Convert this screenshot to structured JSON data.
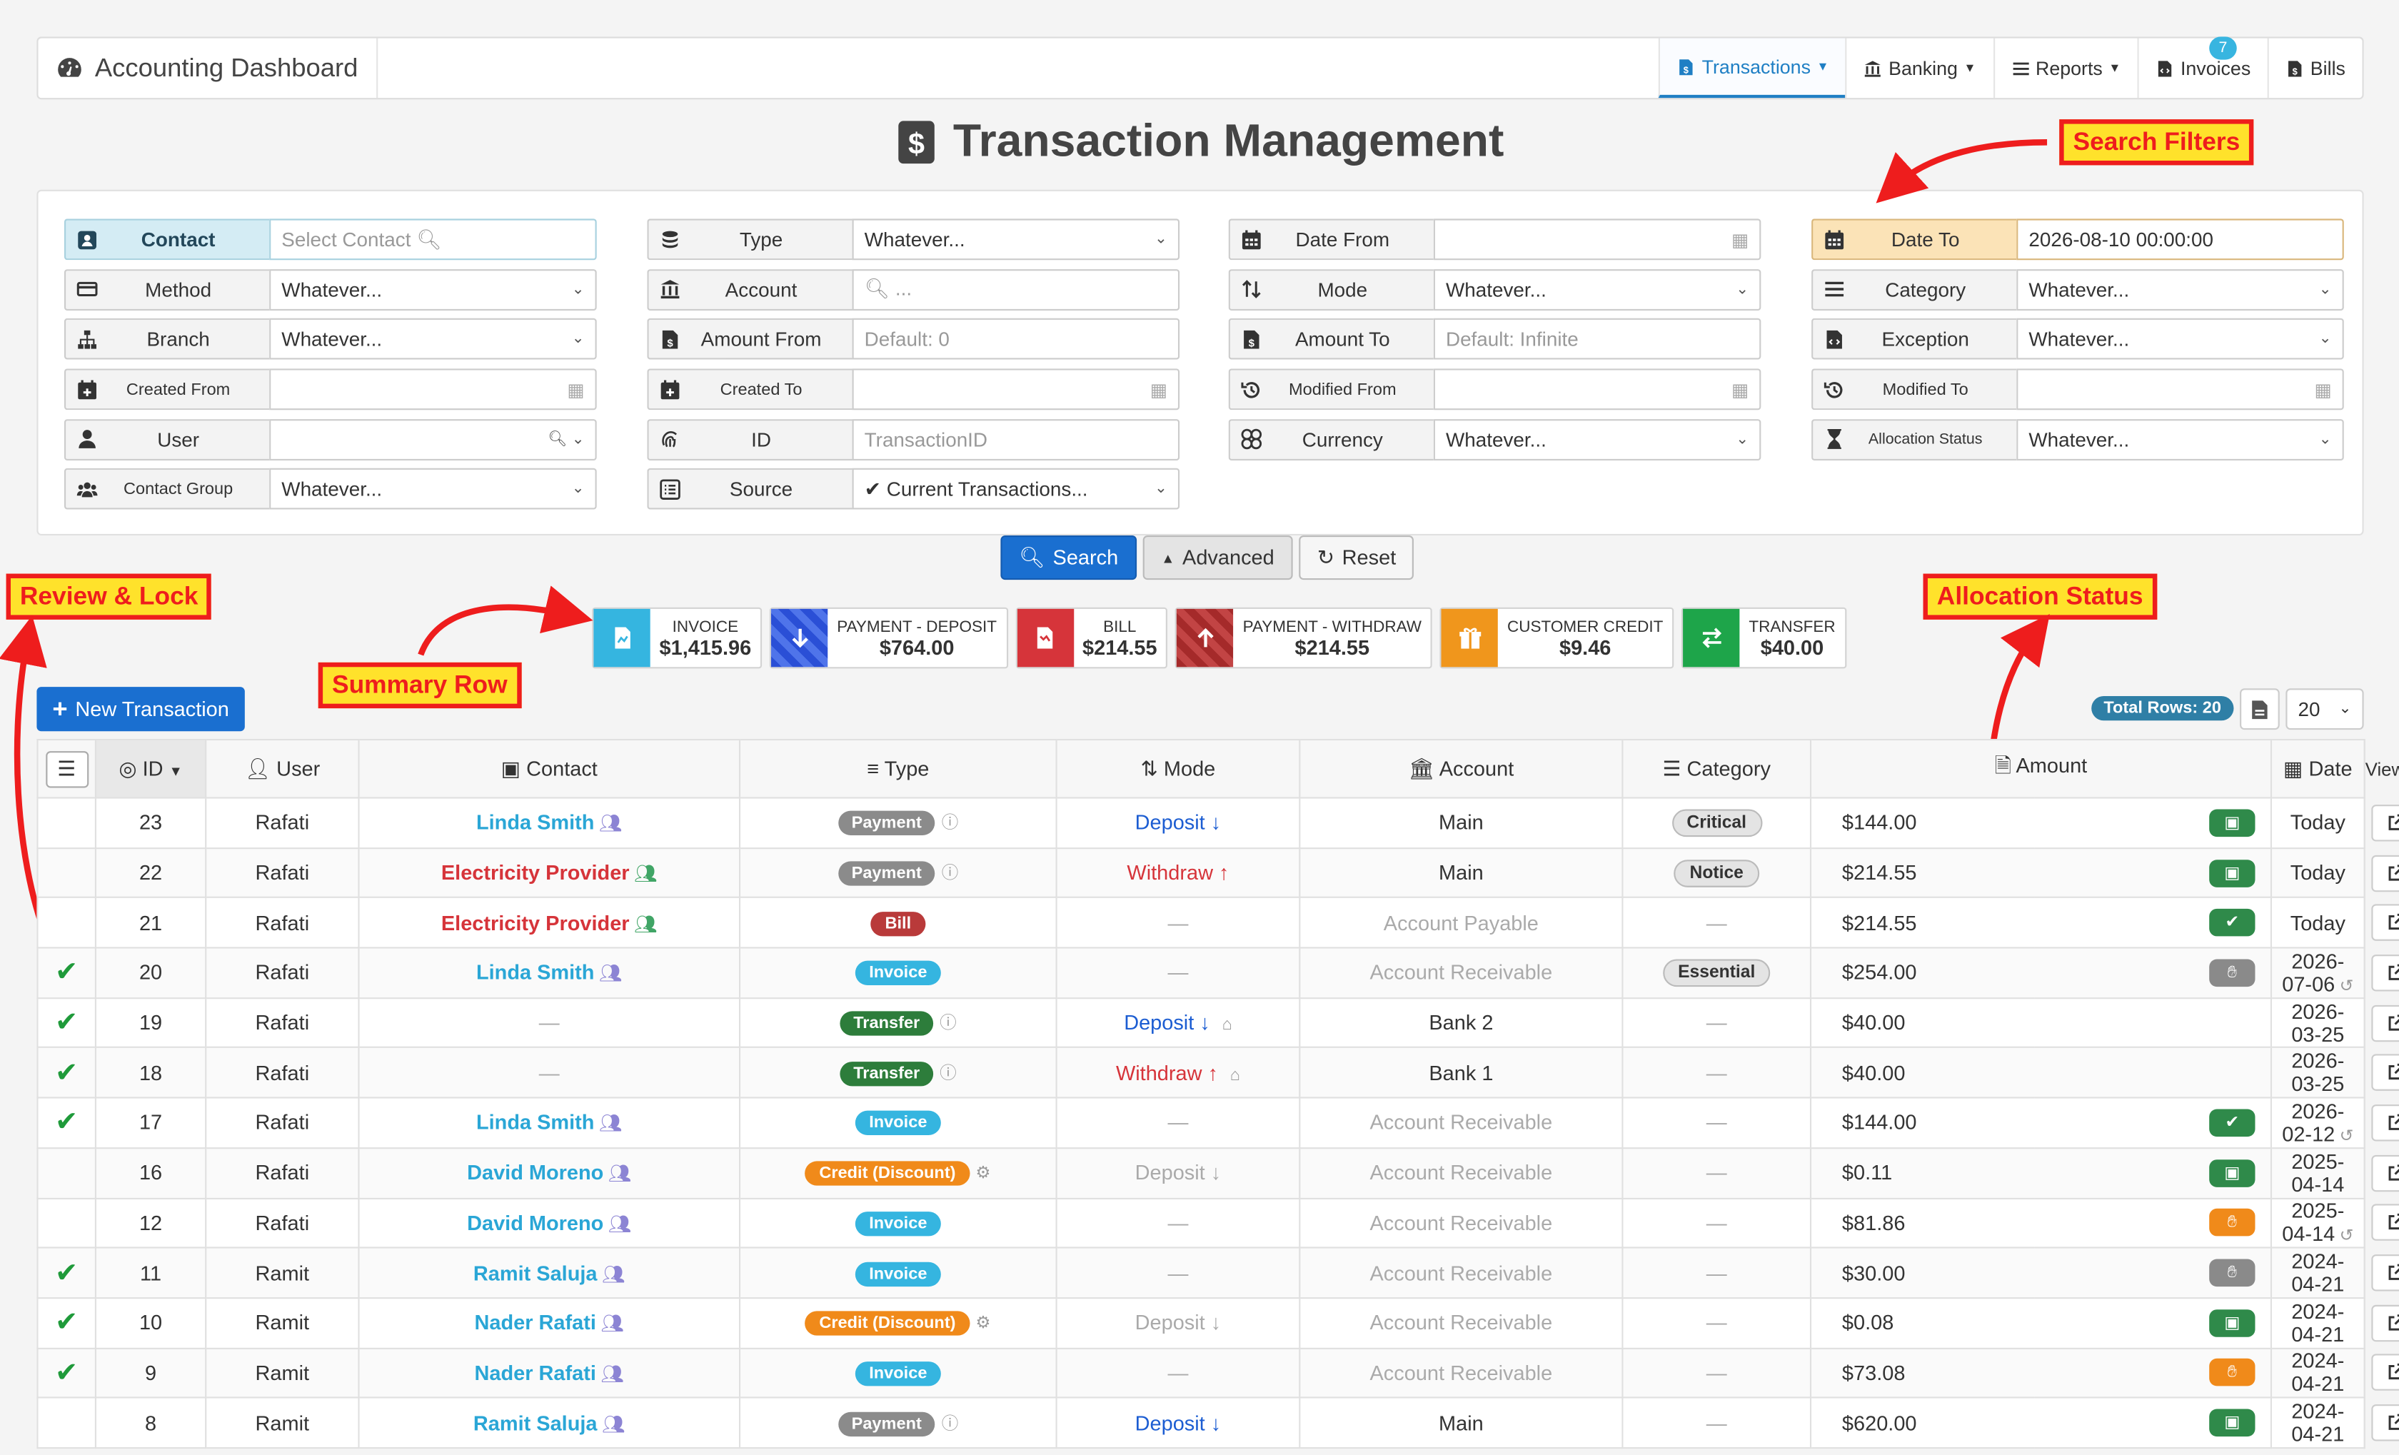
{
  "app": {
    "title": "Accounting Dashboard"
  },
  "nav": {
    "items": [
      {
        "label": "Transactions",
        "active": true,
        "caret": true
      },
      {
        "label": "Banking",
        "caret": true
      },
      {
        "label": "Reports",
        "caret": true
      },
      {
        "label": "Invoices",
        "badge": "7"
      },
      {
        "label": "Bills"
      }
    ]
  },
  "page": {
    "title": "Transaction Management"
  },
  "filters": {
    "col1": [
      {
        "label": "Contact",
        "value": "Select Contact",
        "placeholder": true,
        "kind": "search"
      },
      {
        "label": "Method",
        "value": "Whatever...",
        "kind": "select"
      },
      {
        "label": "Branch",
        "value": "Whatever...",
        "kind": "select"
      },
      {
        "label": "Created From",
        "value": "",
        "kind": "date"
      },
      {
        "label": "User",
        "value": "",
        "kind": "searchselect"
      },
      {
        "label": "Contact Group",
        "value": "Whatever...",
        "kind": "select"
      }
    ],
    "col2": [
      {
        "label": "Type",
        "value": "Whatever...",
        "kind": "select"
      },
      {
        "label": "Account",
        "value": "...",
        "placeholder": true,
        "kind": "lookup"
      },
      {
        "label": "Amount From",
        "value": "Default: 0",
        "placeholder": true,
        "kind": "text"
      },
      {
        "label": "Created To",
        "value": "",
        "kind": "date"
      },
      {
        "label": "ID",
        "value": "TransactionID",
        "placeholder": true,
        "kind": "text"
      },
      {
        "label": "Source",
        "value": "✔ Current Transactions...",
        "kind": "select"
      }
    ],
    "col3": [
      {
        "label": "Date From",
        "value": "",
        "kind": "date"
      },
      {
        "label": "Mode",
        "value": "Whatever...",
        "kind": "select"
      },
      {
        "label": "Amount To",
        "value": "Default: Infinite",
        "placeholder": true,
        "kind": "text"
      },
      {
        "label": "Modified From",
        "value": "",
        "kind": "date"
      },
      {
        "label": "Currency",
        "value": "Whatever...",
        "kind": "select"
      }
    ],
    "col4": [
      {
        "label": "Date To",
        "value": "2026-08-10 00:00:00",
        "kind": "text"
      },
      {
        "label": "Category",
        "value": "Whatever...",
        "kind": "select"
      },
      {
        "label": "Exception",
        "value": "Whatever...",
        "kind": "select"
      },
      {
        "label": "Modified To",
        "value": "",
        "kind": "date"
      },
      {
        "label": "Allocation Status",
        "value": "Whatever...",
        "kind": "select"
      }
    ]
  },
  "buttons": {
    "search": "Search",
    "advanced": "Advanced",
    "reset": "Reset",
    "new_transaction": "New Transaction"
  },
  "summary": [
    {
      "label": "INVOICE",
      "value": "$1,415.96",
      "color": "#35b5e0"
    },
    {
      "label": "PAYMENT - DEPOSIT",
      "value": "$764.00",
      "color": "#2a4fd6"
    },
    {
      "label": "BILL",
      "value": "$214.55",
      "color": "#d6343a"
    },
    {
      "label": "PAYMENT - WITHDRAW",
      "value": "$214.55",
      "color": "#a52a2a"
    },
    {
      "label": "CUSTOMER CREDIT",
      "value": "$9.46",
      "color": "#f0961c"
    },
    {
      "label": "TRANSFER",
      "value": "$40.00",
      "color": "#1ea54a"
    }
  ],
  "callouts": {
    "search_filters": "Search Filters",
    "review_lock": "Review & Lock",
    "summary_row": "Summary Row",
    "allocation_status": "Allocation Status"
  },
  "table": {
    "total_rows": "Total Rows: 20",
    "page_size": "20",
    "headers": [
      "ID",
      "User",
      "Contact",
      "Type",
      "Mode",
      "Account",
      "Category",
      "Amount",
      "Date",
      "View"
    ],
    "rows": [
      {
        "check": false,
        "id": "23",
        "user": "Rafati",
        "contact": "Linda Smith",
        "ccolor": "blue",
        "type": "Payment",
        "tinfo": true,
        "mode": "Deposit",
        "mstyle": "deposit",
        "account": "Main",
        "amuted": false,
        "category": "Critical",
        "amount": "$144.00",
        "alloc": "cash",
        "date": "Today",
        "hist": false
      },
      {
        "check": false,
        "id": "22",
        "user": "Rafati",
        "contact": "Electricity Provider",
        "ccolor": "red",
        "type": "Payment",
        "tinfo": true,
        "mode": "Withdraw",
        "mstyle": "withdraw",
        "account": "Main",
        "amuted": false,
        "category": "Notice",
        "amount": "$214.55",
        "alloc": "cash",
        "date": "Today",
        "hist": false
      },
      {
        "check": false,
        "id": "21",
        "user": "Rafati",
        "contact": "Electricity Provider",
        "ccolor": "red",
        "type": "Bill",
        "tinfo": false,
        "mode": "",
        "mstyle": "dash",
        "account": "Account Payable",
        "amuted": true,
        "category": "",
        "amount": "$214.55",
        "alloc": "check",
        "date": "Today",
        "hist": false
      },
      {
        "check": true,
        "id": "20",
        "user": "Rafati",
        "contact": "Linda Smith",
        "ccolor": "blue",
        "type": "Invoice",
        "tinfo": false,
        "mode": "",
        "mstyle": "dash",
        "account": "Account Receivable",
        "amuted": true,
        "category": "Essential",
        "amount": "$254.00",
        "alloc": "hand",
        "date": "2026-07-06",
        "hist": true
      },
      {
        "check": true,
        "id": "19",
        "user": "Rafati",
        "contact": "",
        "ccolor": "",
        "type": "Transfer",
        "tinfo": true,
        "mode": "Deposit",
        "mstyle": "deposit",
        "account": "Bank 2",
        "amuted": false,
        "category": "",
        "amount": "$40.00",
        "alloc": "",
        "date": "2026-03-25",
        "hist": false
      },
      {
        "check": true,
        "id": "18",
        "user": "Rafati",
        "contact": "",
        "ccolor": "",
        "type": "Transfer",
        "tinfo": true,
        "mode": "Withdraw",
        "mstyle": "withdraw",
        "account": "Bank 1",
        "amuted": false,
        "category": "",
        "amount": "$40.00",
        "alloc": "",
        "date": "2026-03-25",
        "hist": false
      },
      {
        "check": true,
        "id": "17",
        "user": "Rafati",
        "contact": "Linda Smith",
        "ccolor": "blue",
        "type": "Invoice",
        "tinfo": false,
        "mode": "",
        "mstyle": "dash",
        "account": "Account Receivable",
        "amuted": true,
        "category": "",
        "amount": "$144.00",
        "alloc": "check",
        "date": "2026-02-12",
        "hist": true
      },
      {
        "check": false,
        "id": "16",
        "user": "Rafati",
        "contact": "David Moreno",
        "ccolor": "blue",
        "type": "Credit (Discount)",
        "tinfo": true,
        "mode": "Deposit",
        "mstyle": "muted",
        "account": "Account Receivable",
        "amuted": true,
        "category": "",
        "amount": "$0.11",
        "alloc": "cash",
        "date": "2025-04-14",
        "hist": false
      },
      {
        "check": false,
        "id": "12",
        "user": "Rafati",
        "contact": "David Moreno",
        "ccolor": "blue",
        "type": "Invoice",
        "tinfo": false,
        "mode": "",
        "mstyle": "dash",
        "account": "Account Receivable",
        "amuted": true,
        "category": "",
        "amount": "$81.86",
        "alloc": "orange",
        "date": "2025-04-14",
        "hist": true
      },
      {
        "check": true,
        "id": "11",
        "user": "Ramit",
        "contact": "Ramit Saluja",
        "ccolor": "blue",
        "type": "Invoice",
        "tinfo": false,
        "mode": "",
        "mstyle": "dash",
        "account": "Account Receivable",
        "amuted": true,
        "category": "",
        "amount": "$30.00",
        "alloc": "hand",
        "date": "2024-04-21",
        "hist": false
      },
      {
        "check": true,
        "id": "10",
        "user": "Ramit",
        "contact": "Nader Rafati",
        "ccolor": "blue",
        "type": "Credit (Discount)",
        "tinfo": true,
        "mode": "Deposit",
        "mstyle": "muted",
        "account": "Account Receivable",
        "amuted": true,
        "category": "",
        "amount": "$0.08",
        "alloc": "cash",
        "date": "2024-04-21",
        "hist": false
      },
      {
        "check": true,
        "id": "9",
        "user": "Ramit",
        "contact": "Nader Rafati",
        "ccolor": "blue",
        "type": "Invoice",
        "tinfo": false,
        "mode": "",
        "mstyle": "dash",
        "account": "Account Receivable",
        "amuted": true,
        "category": "",
        "amount": "$73.08",
        "alloc": "orange",
        "date": "2024-04-21",
        "hist": false
      },
      {
        "check": false,
        "id": "8",
        "user": "Ramit",
        "contact": "Ramit Saluja",
        "ccolor": "blue",
        "type": "Payment",
        "tinfo": true,
        "mode": "Deposit",
        "mstyle": "deposit",
        "account": "Main",
        "amuted": false,
        "category": "",
        "amount": "$620.00",
        "alloc": "cash",
        "date": "2024-04-21",
        "hist": false
      }
    ]
  }
}
